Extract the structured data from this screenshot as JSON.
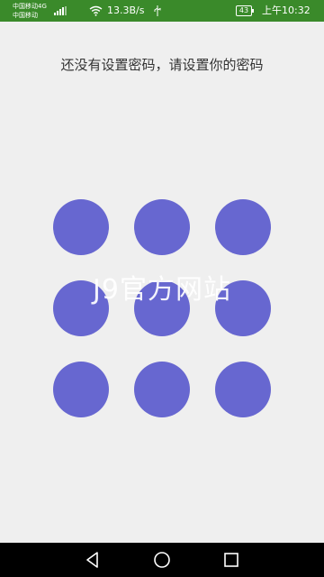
{
  "status_bar": {
    "carrier_1": "中国移动4G",
    "carrier_2": "中国移动",
    "net_speed": "13.3B/s",
    "battery": "43",
    "time": "上午10:32",
    "icons": [
      "signal-icon",
      "wifi-icon",
      "usb-icon",
      "battery-icon"
    ],
    "background_color": "#3a8a2a"
  },
  "prompt": {
    "text": "还没有设置密码，请设置你的密码"
  },
  "pattern_lock": {
    "dot_color": "#6767d0",
    "dots": [
      1,
      2,
      3,
      4,
      5,
      6,
      7,
      8,
      9
    ]
  },
  "watermark": {
    "text": "J9官方网站"
  },
  "nav_bar": {
    "icons": [
      "back-icon",
      "home-icon",
      "recent-apps-icon"
    ]
  }
}
